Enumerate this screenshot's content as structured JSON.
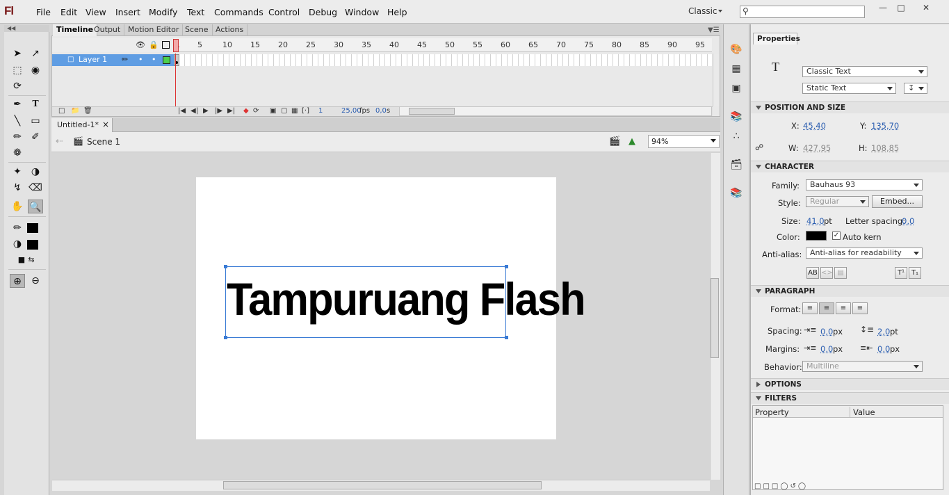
{
  "app": {
    "logo": "Fl",
    "workspace": "Classic"
  },
  "menu": [
    "File",
    "Edit",
    "View",
    "Insert",
    "Modify",
    "Text",
    "Commands",
    "Control",
    "Debug",
    "Window",
    "Help"
  ],
  "window_controls": [
    "—",
    "□",
    "✕"
  ],
  "panel_tabs": [
    "Timeline",
    "Output",
    "Motion Editor",
    "Scene",
    "Actions"
  ],
  "timeline": {
    "layer_name": "Layer 1",
    "ruler": [
      "1",
      "5",
      "10",
      "15",
      "20",
      "25",
      "30",
      "35",
      "40",
      "45",
      "50",
      "55",
      "60",
      "65",
      "70",
      "75",
      "80",
      "85",
      "90",
      "95"
    ],
    "current_frame": "1",
    "fps": "25,00",
    "fps_unit": "fps",
    "elapsed": "0,0",
    "elapsed_unit": "s"
  },
  "document": {
    "tab": "Untitled-1*",
    "close": "×",
    "scene": "Scene 1",
    "zoom": "94%"
  },
  "stage": {
    "text": "Tampuruang Flash"
  },
  "properties": {
    "tab": "Properties",
    "text_engine": "Classic Text",
    "text_type": "Static Text",
    "sections": {
      "position": "POSITION AND SIZE",
      "character": "CHARACTER",
      "paragraph": "PARAGRAPH",
      "options": "OPTIONS",
      "filters": "FILTERS"
    },
    "position": {
      "x_label": "X:",
      "x": "45,40",
      "y_label": "Y:",
      "y": "135,70",
      "w_label": "W:",
      "w": "427,95",
      "h_label": "H:",
      "h": "108,85"
    },
    "character": {
      "family_label": "Family:",
      "family": "Bauhaus 93",
      "style_label": "Style:",
      "style": "Regular",
      "embed": "Embed...",
      "size_label": "Size:",
      "size": "41,0",
      "size_unit": "pt",
      "letter_spacing_label": "Letter spacing:",
      "letter_spacing": "0,0",
      "color_label": "Color:",
      "color": "#000000",
      "auto_kern": "Auto kern",
      "anti_alias_label": "Anti-alias:",
      "anti_alias": "Anti-alias for readability"
    },
    "paragraph": {
      "format_label": "Format:",
      "spacing_label": "Spacing:",
      "indent": "0,0",
      "indent_unit": "px",
      "line_spacing": "2,0",
      "line_unit": "pt",
      "margins_label": "Margins:",
      "margin_left": "0,0",
      "margin_left_unit": "px",
      "margin_right": "0,0",
      "margin_right_unit": "px",
      "behavior_label": "Behavior:",
      "behavior": "Multiline"
    },
    "filters_columns": [
      "Property",
      "Value"
    ]
  },
  "colors": {
    "accent": "#3a7bd5",
    "layer_highlight": "#5f9de3",
    "playhead": "#dd3333",
    "link": "#2a5db0"
  }
}
